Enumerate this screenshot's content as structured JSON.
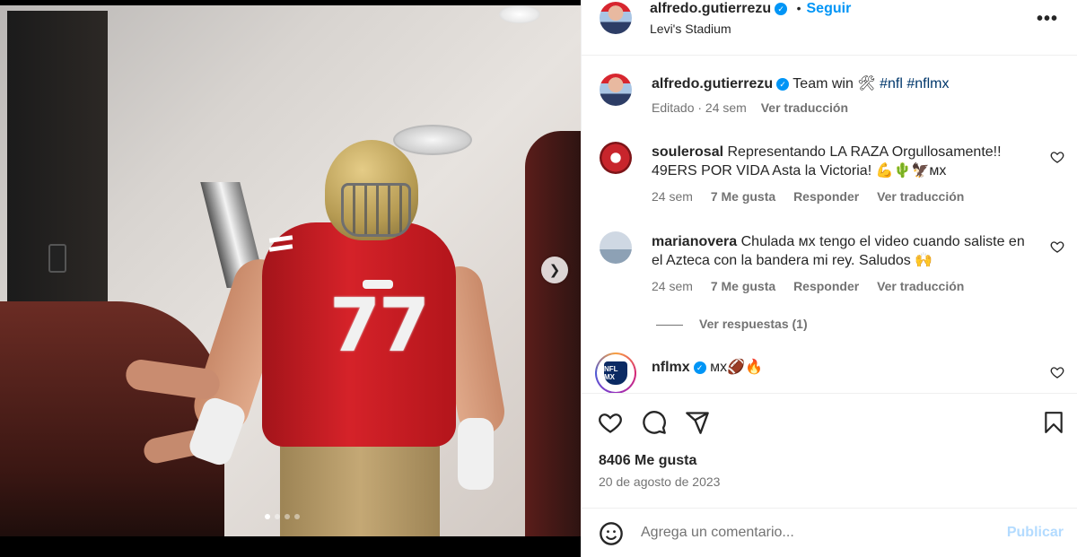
{
  "post": {
    "author": "alfredo.gutierrezu",
    "location": "Levi's Stadium",
    "follow_label": "Seguir",
    "dot": "•",
    "more_label": "•••",
    "caption_text": "Team win 🛠",
    "hashtags": "#nfl #nflmx",
    "caption_meta": "Editado · 24 sem",
    "see_translation": "Ver traducción",
    "jersey_number": "77",
    "carousel": {
      "total": 4,
      "active_index": 0
    }
  },
  "comments": [
    {
      "user": "soulerosal",
      "text_line1": "Representando LA RAZA Orgullosamente!!",
      "text_line2": "49ERS POR VIDA Asta la Victoria! 💪🌵🦅ᴍx",
      "time": "24 sem",
      "likes": "7 Me gusta",
      "reply": "Responder",
      "translate": "Ver traducción"
    },
    {
      "user": "marianovera",
      "text_line1": "Chulada ᴍx tengo el video cuando saliste en",
      "text_line2": "el Azteca con la bandera mi rey. Saludos 🙌",
      "time": "24 sem",
      "likes": "7 Me gusta",
      "reply": "Responder",
      "translate": "Ver traducción",
      "view_replies": "Ver respuestas (1)"
    },
    {
      "user": "nflmx",
      "text_line1": "ᴍx🏈🔥",
      "avatar_text": "NFL MX"
    }
  ],
  "footer": {
    "likes": "8406 Me gusta",
    "date": "20 de agosto de 2023",
    "comment_placeholder": "Agrega un comentario...",
    "publish_label": "Publicar"
  },
  "colors": {
    "accent": "#0095f6",
    "hashtag": "#00376b",
    "muted": "#737373",
    "publish_disabled": "#b3dbff"
  },
  "icons": [
    "heart-icon",
    "comment-icon",
    "share-icon",
    "bookmark-icon",
    "emoji-icon",
    "more-options-icon",
    "chevron-right-icon",
    "verified-icon"
  ]
}
